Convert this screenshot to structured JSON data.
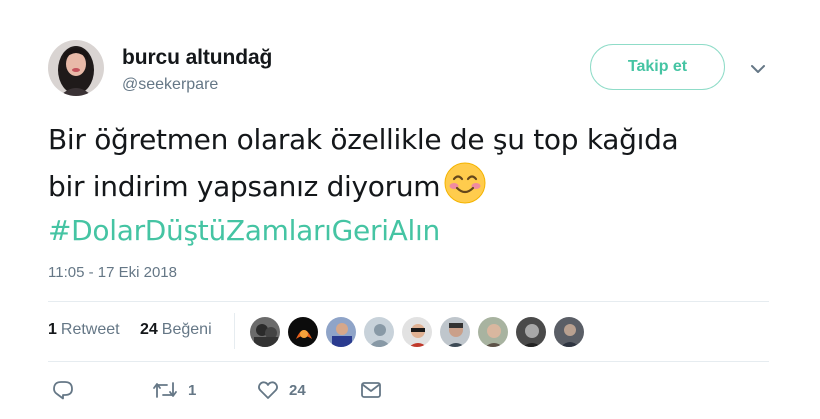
{
  "author": {
    "display_name": "burcu altundağ",
    "screen_name": "@seekerpare"
  },
  "follow_button": {
    "label": "Takip et"
  },
  "tweet": {
    "line1": "Bir öğretmen olarak özellikle de şu top kağıda",
    "line2": "bir indirim yapsanız diyorum",
    "hashtag": "#DolarDüştüZamlarıGeriAlın",
    "timestamp": "11:05 - 17 Eki 2018"
  },
  "stats": {
    "retweet_count": "1",
    "retweet_label": "Retweet",
    "like_count": "24",
    "like_label": "Beğeni"
  },
  "actions": {
    "retweet_count": "1",
    "like_count": "24"
  },
  "colors": {
    "accent": "#45c4a3",
    "secondary_text": "#657786",
    "divider": "#e6ecf0"
  },
  "icons": [
    "chevron-down-icon",
    "reply-icon",
    "retweet-icon",
    "heart-icon",
    "envelope-icon",
    "smiling-face-emoji"
  ]
}
